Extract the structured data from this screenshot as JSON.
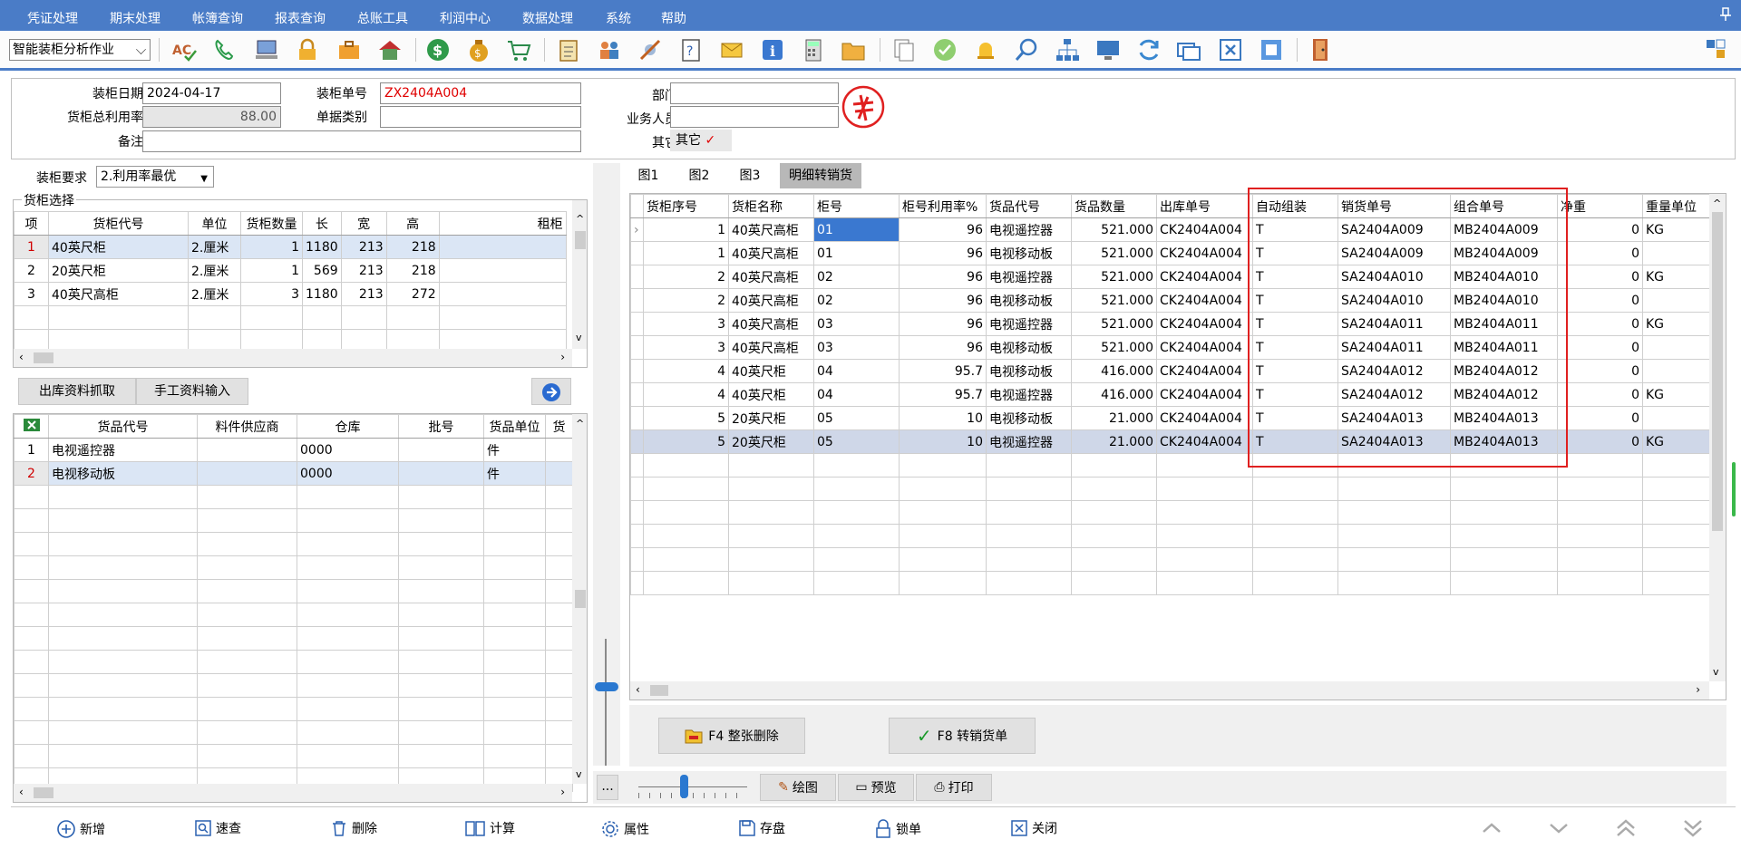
{
  "menu": [
    "凭证处理",
    "期末处理",
    "帐簿查询",
    "报表查询",
    "总账工具",
    "利润中心",
    "数据处理",
    "系统",
    "帮助"
  ],
  "toolbar": {
    "mode": "智能装柜分析作业"
  },
  "header": {
    "date_label": "装柜日期",
    "date_value": "2024-04-17",
    "no_label": "装柜单号",
    "no_value": "ZX2404A004",
    "dept_label": "部门",
    "dept_value": "",
    "util_label": "货柜总利用率",
    "util_value": "88.00",
    "type_label": "单据类别",
    "type_value": "",
    "staff_label": "业务人员",
    "staff_value": "",
    "note_label": "备注",
    "note_value": "",
    "other_label": "其它",
    "other_value": "其它"
  },
  "req": {
    "label": "装柜要求",
    "value": "2.利用率最优"
  },
  "container": {
    "group_label": "货柜选择",
    "columns": [
      "项",
      "货柜代号",
      "单位",
      "货柜数量",
      "长",
      "宽",
      "高",
      "租柜"
    ],
    "rows": [
      [
        "1",
        "40英尺柜",
        "2.厘米",
        "1",
        "1180",
        "213",
        "218"
      ],
      [
        "2",
        "20英尺柜",
        "2.厘米",
        "1",
        "569",
        "213",
        "218"
      ],
      [
        "3",
        "40英尺高柜",
        "2.厘米",
        "3",
        "1180",
        "213",
        "272"
      ]
    ]
  },
  "left_buttons": {
    "fetch": "出库资料抓取",
    "manual": "手工资料输入"
  },
  "goods": {
    "columns": [
      "货品代号",
      "料件供应商",
      "仓库",
      "批号",
      "货品单位",
      "货"
    ],
    "rows": [
      [
        "1",
        "电视遥控器",
        "",
        "0000",
        "",
        "件"
      ],
      [
        "2",
        "电视移动板",
        "",
        "0000",
        "",
        "件"
      ]
    ]
  },
  "tabs": [
    "图1",
    "图2",
    "图3",
    "明细转销货"
  ],
  "detail": {
    "columns": [
      "货柜序号",
      "货柜名称",
      "柜号",
      "柜号利用率%",
      "货品代号",
      "货品数量",
      "出库单号",
      "自动组装",
      "销货单号",
      "组合单号",
      "净重",
      "重量单位"
    ],
    "rows": [
      [
        "1",
        "40英尺高柜",
        "01",
        "96",
        "电视遥控器",
        "521.000",
        "CK2404A004",
        "T",
        "SA2404A009",
        "MB2404A009",
        "0",
        "KG"
      ],
      [
        "1",
        "40英尺高柜",
        "01",
        "96",
        "电视移动板",
        "521.000",
        "CK2404A004",
        "T",
        "SA2404A009",
        "MB2404A009",
        "0",
        ""
      ],
      [
        "2",
        "40英尺高柜",
        "02",
        "96",
        "电视遥控器",
        "521.000",
        "CK2404A004",
        "T",
        "SA2404A010",
        "MB2404A010",
        "0",
        "KG"
      ],
      [
        "2",
        "40英尺高柜",
        "02",
        "96",
        "电视移动板",
        "521.000",
        "CK2404A004",
        "T",
        "SA2404A010",
        "MB2404A010",
        "0",
        ""
      ],
      [
        "3",
        "40英尺高柜",
        "03",
        "96",
        "电视遥控器",
        "521.000",
        "CK2404A004",
        "T",
        "SA2404A011",
        "MB2404A011",
        "0",
        "KG"
      ],
      [
        "3",
        "40英尺高柜",
        "03",
        "96",
        "电视移动板",
        "521.000",
        "CK2404A004",
        "T",
        "SA2404A011",
        "MB2404A011",
        "0",
        ""
      ],
      [
        "4",
        "40英尺柜",
        "04",
        "95.7",
        "电视移动板",
        "416.000",
        "CK2404A004",
        "T",
        "SA2404A012",
        "MB2404A012",
        "0",
        ""
      ],
      [
        "4",
        "40英尺柜",
        "04",
        "95.7",
        "电视遥控器",
        "416.000",
        "CK2404A004",
        "T",
        "SA2404A012",
        "MB2404A012",
        "0",
        "KG"
      ],
      [
        "5",
        "20英尺柜",
        "05",
        "10",
        "电视移动板",
        "21.000",
        "CK2404A004",
        "T",
        "SA2404A013",
        "MB2404A013",
        "0",
        ""
      ],
      [
        "5",
        "20英尺柜",
        "05",
        "10",
        "电视遥控器",
        "21.000",
        "CK2404A004",
        "T",
        "SA2404A013",
        "MB2404A013",
        "0",
        "KG"
      ]
    ]
  },
  "actions": {
    "f4": "F4 整张删除",
    "f8": "F8 转销货单",
    "draw": "绘图",
    "preview": "预览",
    "print": "打印",
    "more": "..."
  },
  "bottom": [
    "新增",
    "速查",
    "删除",
    "计算",
    "属性",
    "存盘",
    "锁单",
    "关闭"
  ],
  "colors": {
    "menu": "#4a7cc7",
    "red_text": "#e00000",
    "highlight": "#e02020"
  }
}
